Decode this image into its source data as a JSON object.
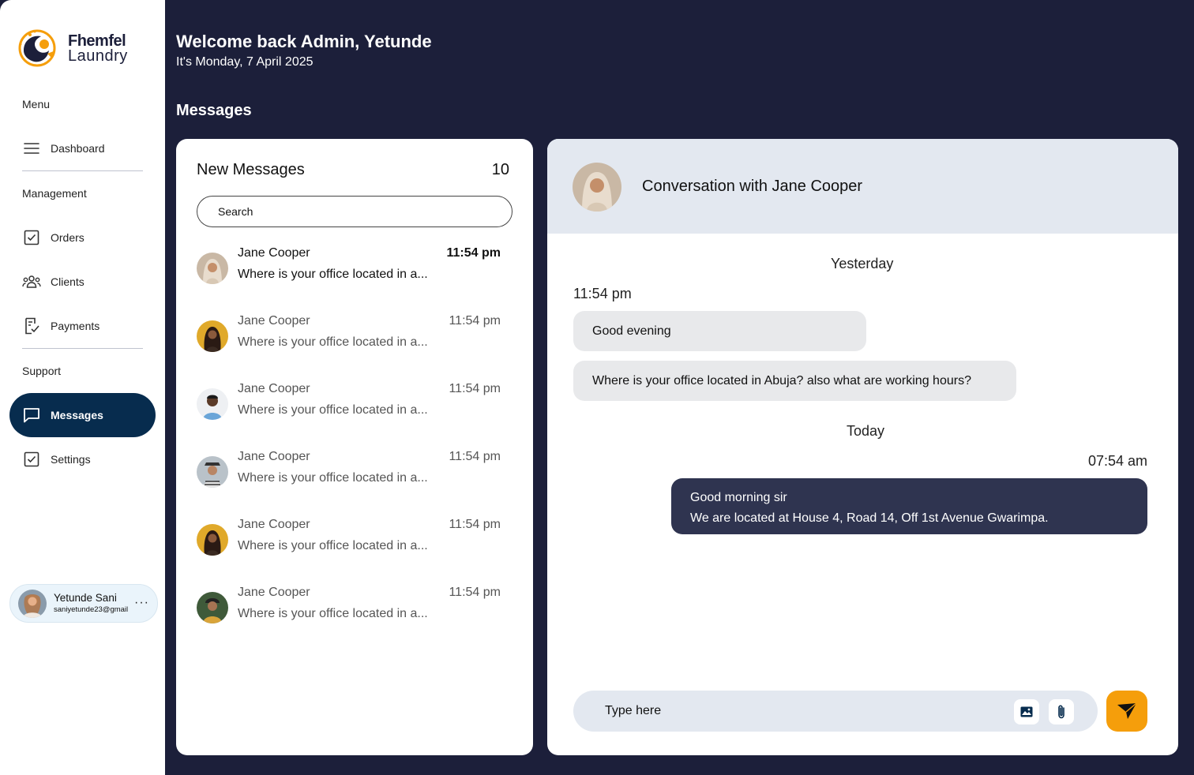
{
  "brand": {
    "line1": "Fhemfel",
    "line2": "Laundry",
    "accent": "#f59e0b",
    "navy": "#1c1f3a"
  },
  "sidebar": {
    "menu_label": "Menu",
    "management_label": "Management",
    "support_label": "Support",
    "items": {
      "dashboard": {
        "label": "Dashboard",
        "icon": "menu-lines-icon"
      },
      "orders": {
        "label": "Orders",
        "icon": "checkbox-icon"
      },
      "clients": {
        "label": "Clients",
        "icon": "users-icon"
      },
      "payments": {
        "label": "Payments",
        "icon": "receipt-check-icon"
      },
      "messages": {
        "label": "Messages",
        "icon": "chat-icon",
        "active": true
      },
      "settings": {
        "label": "Settings",
        "icon": "checkbox-icon"
      }
    },
    "user": {
      "name": "Yetunde Sani",
      "email": "saniyetunde23@gmail",
      "more": "···"
    }
  },
  "header": {
    "welcome": "Welcome back Admin, Yetunde",
    "date": "It's Monday, 7 April 2025",
    "page_title": "Messages"
  },
  "messages_list": {
    "title": "New Messages",
    "count": "10",
    "search_placeholder": "Search",
    "items": [
      {
        "name": "Jane Cooper",
        "time": "11:54 pm",
        "preview": "Where is your office located in a...",
        "unread": true
      },
      {
        "name": "Jane Cooper",
        "time": "11:54 pm",
        "preview": "Where is your office located in a...",
        "unread": false
      },
      {
        "name": "Jane Cooper",
        "time": "11:54 pm",
        "preview": "Where is your office located in a...",
        "unread": false
      },
      {
        "name": "Jane Cooper",
        "time": "11:54 pm",
        "preview": "Where is your office located in a...",
        "unread": false
      },
      {
        "name": "Jane Cooper",
        "time": "11:54 pm",
        "preview": "Where is your office located in a...",
        "unread": false
      },
      {
        "name": "Jane Cooper",
        "time": "11:54 pm",
        "preview": "Where is your office located in a...",
        "unread": false
      }
    ]
  },
  "conversation": {
    "title": "Conversation with Jane Cooper",
    "yesterday_label": "Yesterday",
    "yesterday_time": "11:54 pm",
    "incoming": [
      "Good evening",
      "Where is your office located in Abuja? also what are working hours?"
    ],
    "today_label": "Today",
    "today_time": "07:54 am",
    "outgoing": [
      "Good morning sir",
      "We are located at House 4, Road 14, Off 1st Avenue Gwarimpa."
    ],
    "composer_placeholder": "Type here"
  }
}
